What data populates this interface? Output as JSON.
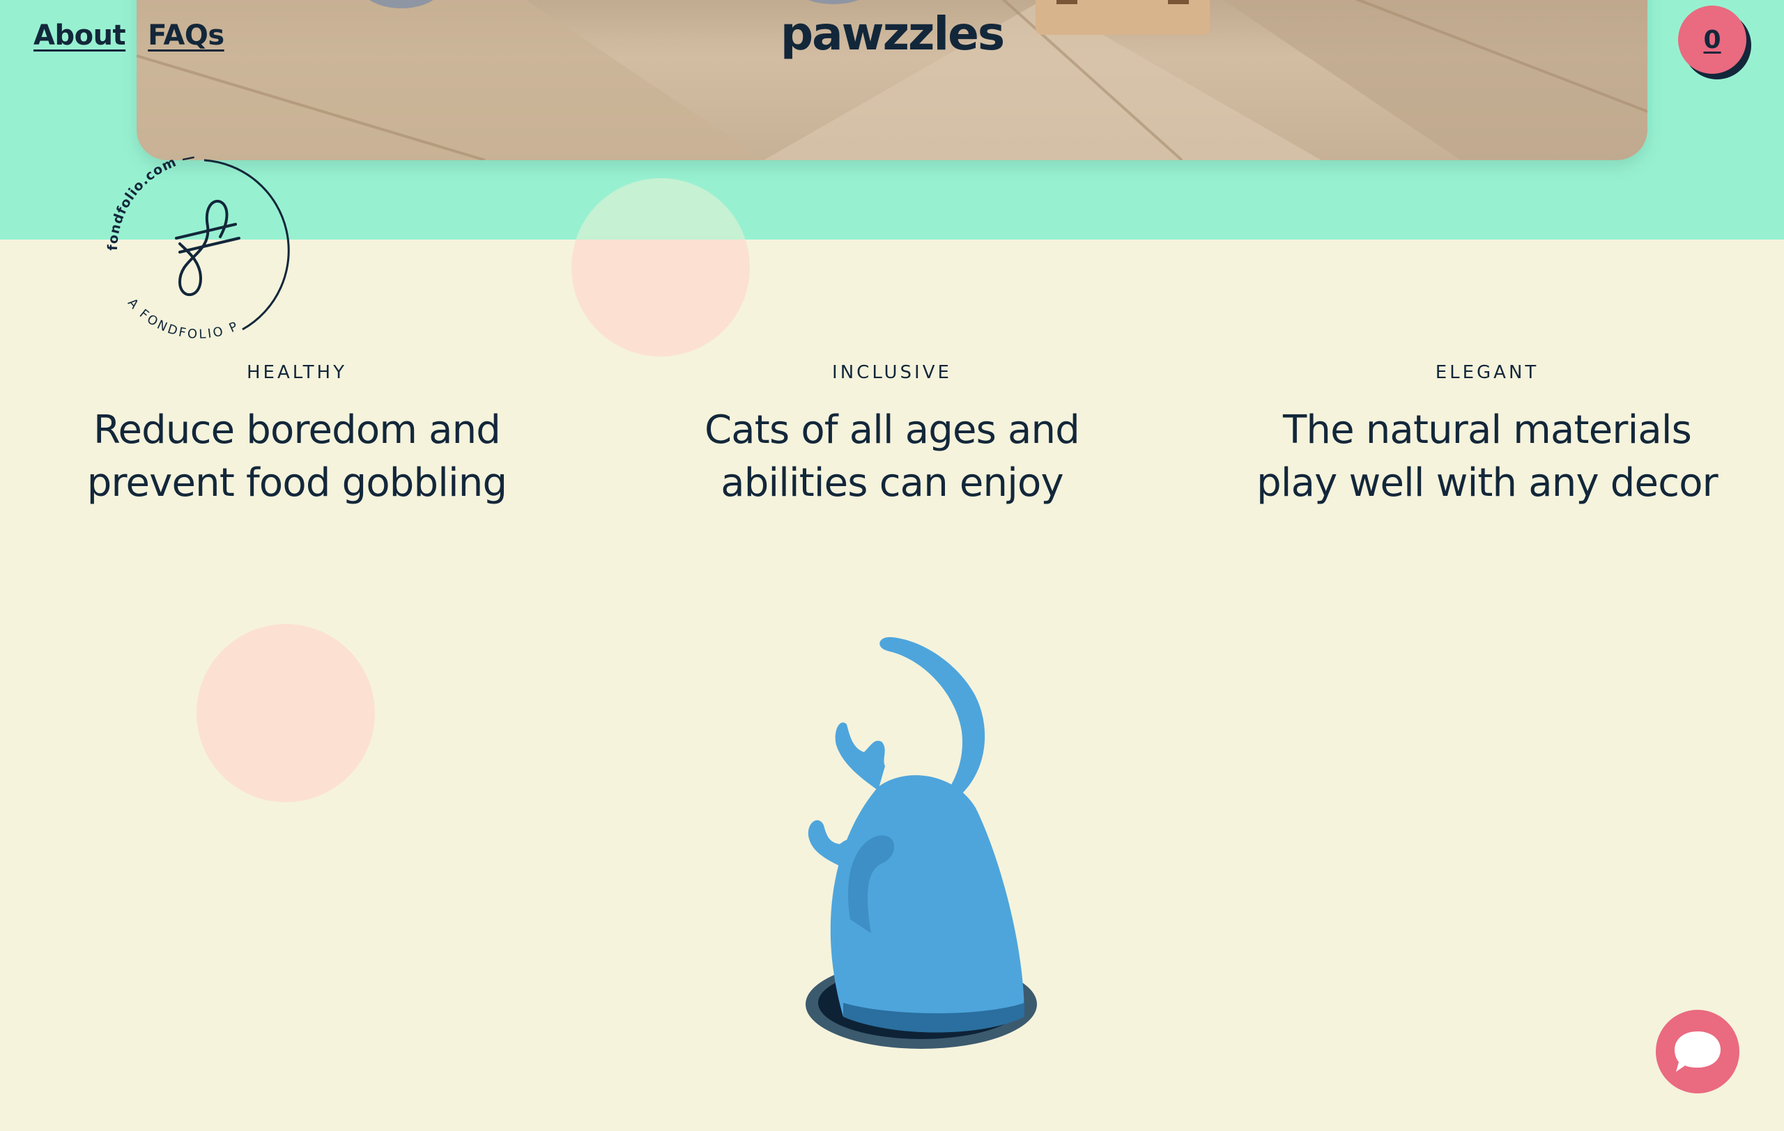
{
  "nav": {
    "links": [
      {
        "label": "About"
      },
      {
        "label": "FAQs"
      }
    ]
  },
  "brand": {
    "logo_text": "pawzzles"
  },
  "cart": {
    "count": "0"
  },
  "badge": {
    "top_text": "fondfolio.com —",
    "bottom_text": "A FONDFOLIO PROJECT —",
    "icon": "fondfolio-monogram-icon"
  },
  "features": [
    {
      "kicker": "HEALTHY",
      "headline_line1": "Reduce boredom and",
      "headline_line2": "prevent food gobbling"
    },
    {
      "kicker": "INCLUSIVE",
      "headline_line1": "Cats of all ages and",
      "headline_line2": "abilities can enjoy"
    },
    {
      "kicker": "ELEGANT",
      "headline_line1": "The natural materials",
      "headline_line2": "play well with any decor"
    }
  ],
  "illustration": {
    "icon": "cat-in-hole-icon"
  },
  "chat": {
    "icon": "chat-bubble-icon"
  },
  "colors": {
    "mint": "#97F1D1",
    "cream": "#F5F3DC",
    "peach": "#FCE1D3",
    "pink": "#EA6A80",
    "navy": "#13273A",
    "cat_blue": "#4EA5DC"
  }
}
